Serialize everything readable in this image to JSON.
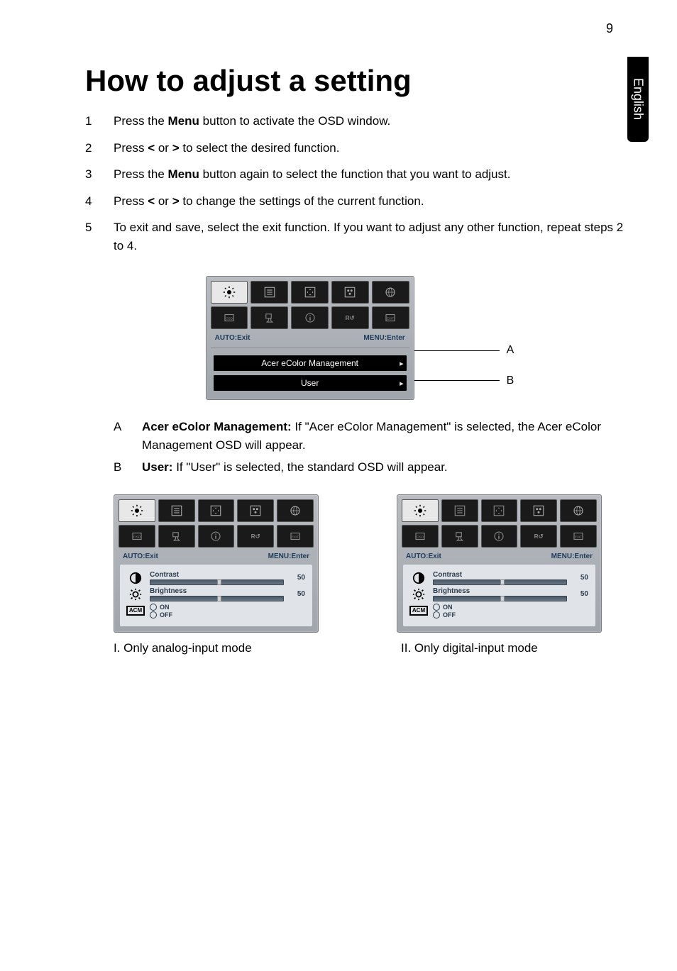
{
  "page_number": "9",
  "side_tab": "English",
  "title": "How to adjust a setting",
  "steps": [
    {
      "num": "1",
      "pre": "Press the ",
      "bold": "Menu",
      "post": " button to activate the OSD window."
    },
    {
      "num": "2",
      "pre": "Press ",
      "bold": "<",
      "mid": " or ",
      "bold2": ">",
      "post": " to select the desired function."
    },
    {
      "num": "3",
      "pre": "Press the ",
      "bold": "Menu",
      "post": " button again to select the function that you want to adjust."
    },
    {
      "num": "4",
      "pre": "Press ",
      "bold": "<",
      "mid": " or ",
      "bold2": ">",
      "post": " to change the settings of the current function."
    },
    {
      "num": "5",
      "pre": "",
      "bold": "",
      "post": "To exit and save, select the exit function. If you want to adjust any other function, repeat steps 2 to 4."
    }
  ],
  "osd_common": {
    "auto_exit": "AUTO:Exit",
    "menu_enter": "MENU:Enter"
  },
  "center_osd": {
    "row_a": "Acer eColor Management",
    "row_b": "User"
  },
  "letters": {
    "a": "A",
    "b": "B"
  },
  "legend": {
    "a_letter": "A",
    "a_bold": "Acer eColor Management:",
    "a_text": " If \"Acer eColor Management\" is selected, the Acer eColor Management OSD will appear.",
    "b_letter": "B",
    "b_bold": "User:",
    "b_text": " If \"User\" is selected, the standard OSD will appear."
  },
  "adjust": {
    "contrast_label": "Contrast",
    "brightness_label": "Brightness",
    "value_50": "50",
    "acm": "ACM",
    "on": "ON",
    "off": "OFF"
  },
  "captions": {
    "left": "I. Only analog-input mode",
    "right": "II. Only digital-input mode"
  },
  "icons": {
    "brightness_sun": "brightness-sun-icon",
    "menu_lines": "menu-lines-icon",
    "move": "move-arrows-icon",
    "rgb": "rgb-dots-icon",
    "globe": "globe-icon",
    "osd": "osd-icon",
    "signal": "signal-icon",
    "info": "info-icon",
    "reset": "reset-icon",
    "exit": "exit-icon",
    "arrow_right": "arrow-right-icon",
    "half_circle": "half-circle-icon",
    "sun_outline": "sun-outline-icon"
  }
}
